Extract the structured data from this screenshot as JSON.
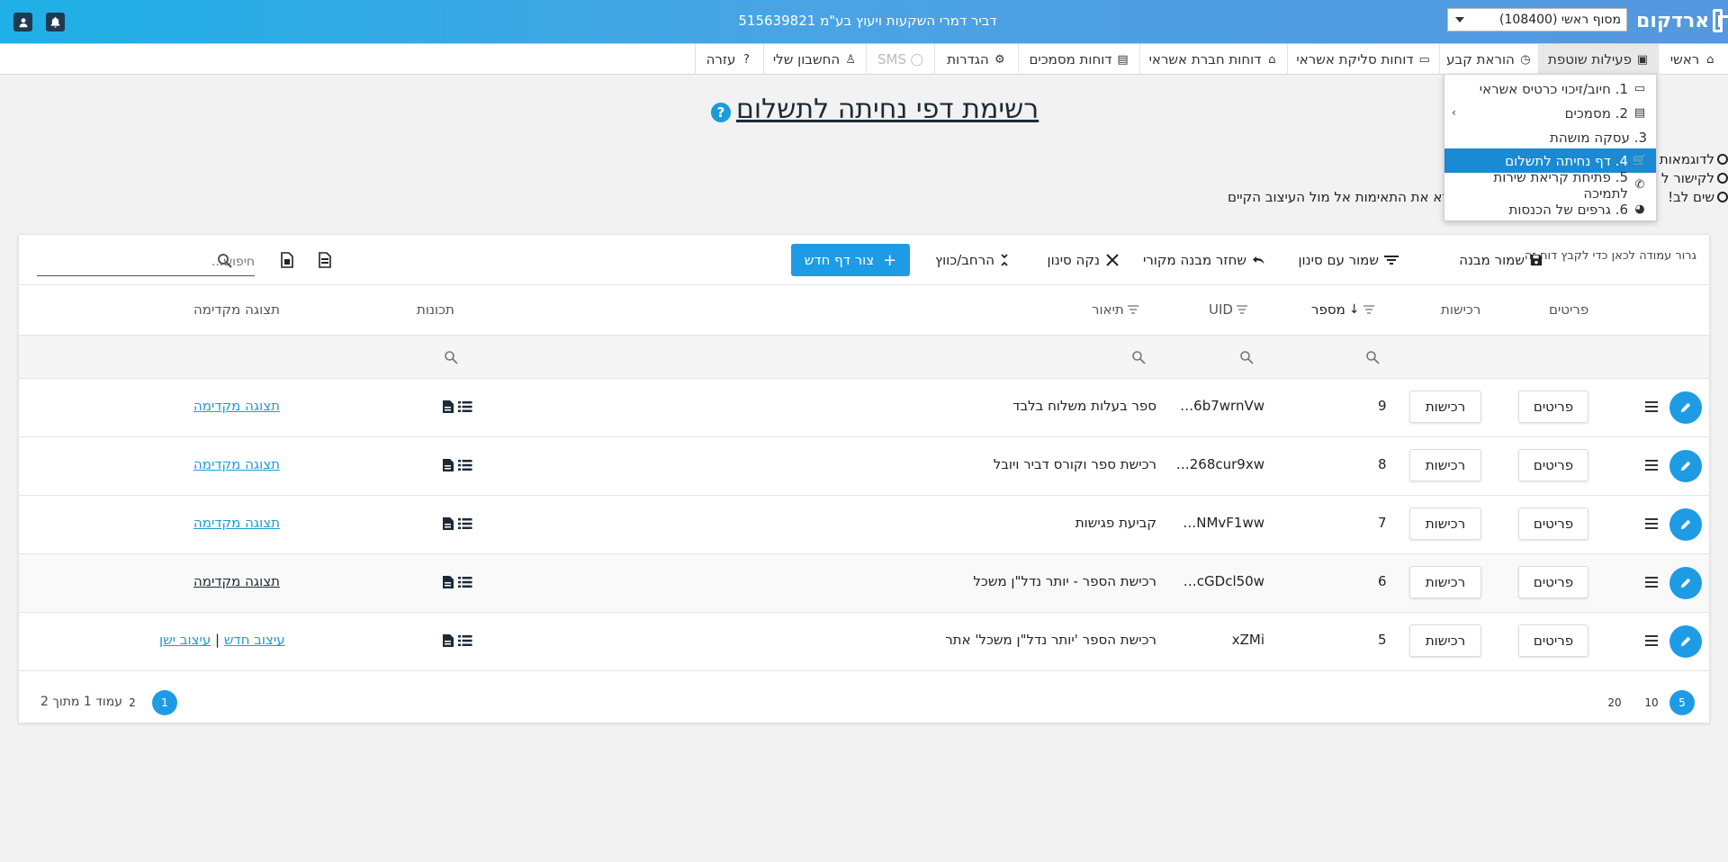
{
  "topbar": {
    "company": "דביר דמרי השקעות ויעוץ בע\"מ 515639821",
    "terminal": "מסוף ראשי (108400)",
    "logo": "ארדקום"
  },
  "nav": [
    {
      "label": "ראשי",
      "icon": "home-icon"
    },
    {
      "label": "פעילות שוטפת",
      "icon": "briefcase-icon"
    },
    {
      "label": "הוראת קבע",
      "icon": "clock-icon"
    },
    {
      "label": "דוחות סליקת אשראי",
      "icon": "credit-card-icon"
    },
    {
      "label": "דוחות חברת אשראי",
      "icon": "bank-icon"
    },
    {
      "label": "דוחות מסמכים",
      "icon": "document-icon"
    },
    {
      "label": "הגדרות",
      "icon": "gears-icon"
    },
    {
      "label": "SMS",
      "icon": "chat-icon"
    },
    {
      "label": "החשבון שלי",
      "icon": "user-tie-icon"
    },
    {
      "label": "עזרה",
      "icon": "question-circle-icon"
    }
  ],
  "dropdown": [
    {
      "label": "1. חיוב/זיכוי כרטיס אשראי",
      "icon": "credit-card-icon"
    },
    {
      "label": "2. מסמכים",
      "icon": "file-icon"
    },
    {
      "label": "3. עסקה מושהת",
      "icon": ""
    },
    {
      "label": "4. דף נחיתה לתשלום",
      "icon": "cart-icon"
    },
    {
      "label": "5. פתיחת קריאת שירות לתמיכה",
      "icon": "phone-icon"
    },
    {
      "label": "6. גרפים של הכנסות",
      "icon": "pie-chart-icon"
    }
  ],
  "page": {
    "title": "רשימת דפי נחיתה לתשלום",
    "help": "?",
    "info1": "לדוגמאות",
    "info2": "לקישור ל",
    "info3": "שים לב!",
    "info3_rest": "וודא את התאימות אל מול העיצוב הקיים"
  },
  "toolbar": {
    "drag_hint": "גרור עמודה לכאן כדי לקבץ דוח זה",
    "save_layout": "שמור מבנה",
    "save_filter": "שמור עם סינון",
    "restore_layout": "שחזר מבנה מקורי",
    "clear_filter": "נקה סינון",
    "expand_collapse": "הרחב/כווץ",
    "new_page": "צור דף חדש",
    "search_placeholder": "חיפוש..."
  },
  "columns": {
    "details": "פריטים",
    "purchases": "רכישות",
    "number": "מספר",
    "uid": "UID",
    "description": "תיאור",
    "features": "תכונות",
    "preview": "תצוגה מקדימה"
  },
  "rows": [
    {
      "number": "9",
      "uid": "6b7wrnVw…",
      "description": "ספר בעלות משלוח בלבד",
      "preview": "תצוגה מקדימה"
    },
    {
      "number": "8",
      "uid": "268cur9xw…",
      "description": "רכישת ספר וקורס דביר ויובל",
      "preview": "תצוגה מקדימה"
    },
    {
      "number": "7",
      "uid": "NMvF1ww…",
      "description": "קביעת פגישות",
      "preview": "תצוגה מקדימה"
    },
    {
      "number": "6",
      "uid": "cGDcl50w…",
      "description": "רכישת הספר - יותר נדל\"ן משכל",
      "preview": "תצוגה מקדימה"
    },
    {
      "number": "5",
      "uid": "xZMi",
      "description": "רכישת הספר 'יותר נדל\"ן משכל' אתר",
      "preview_new": "עיצוב חדש",
      "preview_sep": "|",
      "preview_old": "עיצוב ישן"
    }
  ],
  "row_buttons": {
    "details": "פריטים",
    "purchases": "רכישות"
  },
  "pagination": {
    "sizes": [
      "5",
      "10",
      "20"
    ],
    "pages": [
      "1",
      "2"
    ],
    "info": "עמוד 1 מתוך 2"
  },
  "colors": {
    "accent": "#1e9be5",
    "topbar_start": "#1eb0e6",
    "topbar_end": "#5597e0"
  }
}
